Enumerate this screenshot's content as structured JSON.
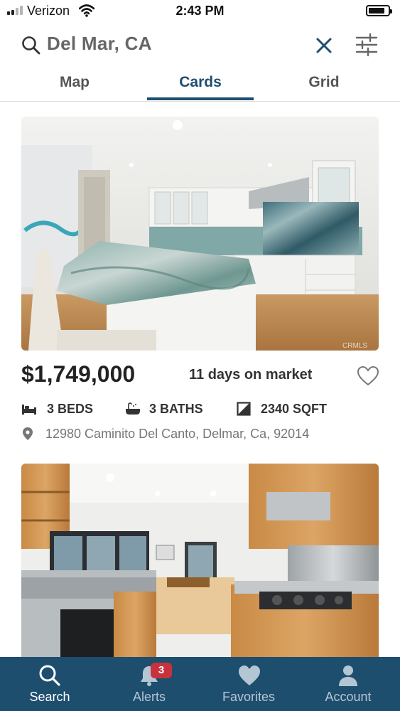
{
  "status_bar": {
    "carrier": "Verizon",
    "time": "2:43 PM",
    "signal_bars_active": 2,
    "signal_bars_total": 4,
    "battery_level": 0.85
  },
  "search": {
    "query": "Del Mar, CA",
    "icons": {
      "search": "search-icon",
      "clear": "close-icon",
      "filter": "filter-sliders-icon"
    }
  },
  "tabs": [
    {
      "label": "Map",
      "active": false
    },
    {
      "label": "Cards",
      "active": true
    },
    {
      "label": "Grid",
      "active": false
    }
  ],
  "listings": [
    {
      "price": "$1,749,000",
      "days_on_market": "11 days on market",
      "beds": "3 BEDS",
      "baths": "3 BATHS",
      "sqft": "2340 SQFT",
      "address": "12980 Caminito Del Canto, Delmar, Ca, 92014",
      "watermark": "CRMLS",
      "photo": "kitchen-photo-marble-island"
    },
    {
      "photo": "kitchen-photo-wood-cabinets"
    }
  ],
  "bottom_nav": [
    {
      "label": "Search",
      "icon": "search-icon",
      "active": true
    },
    {
      "label": "Alerts",
      "icon": "bell-icon",
      "active": false,
      "badge": "3"
    },
    {
      "label": "Favorites",
      "icon": "heart-icon",
      "active": false
    },
    {
      "label": "Account",
      "icon": "user-icon",
      "active": false
    }
  ],
  "colors": {
    "brand": "#1e4e70",
    "nav_background": "#1e4e6e",
    "badge": "#c8323e"
  }
}
